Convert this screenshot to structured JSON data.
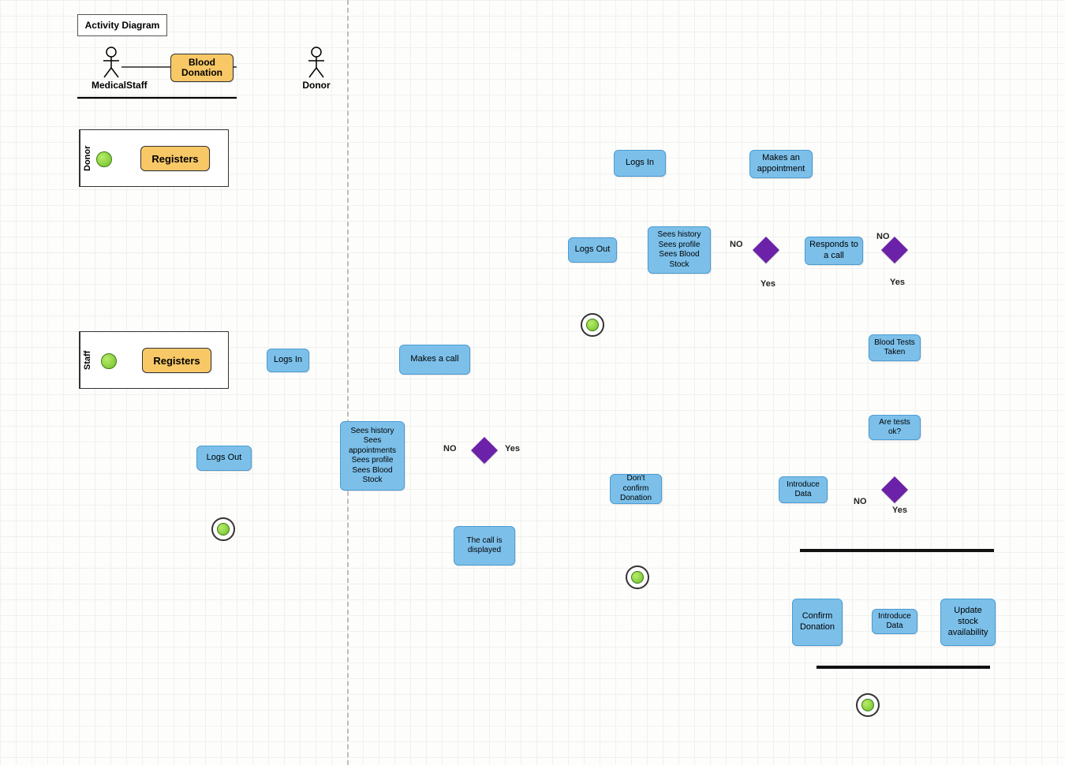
{
  "title": "Activity Diagram",
  "usecase": {
    "label": "Blood Donation",
    "actors": {
      "left": "MedicalStaff",
      "right": "Donor"
    }
  },
  "swimlanes": {
    "donor": "Donor",
    "staff": "Staff"
  },
  "nodes": {
    "registers": "Registers",
    "logsIn": "Logs In",
    "makesAppt": "Makes an appointment",
    "respondsCall": "Responds to a call",
    "seesDonor": "Sees history\nSees profile\nSees Blood Stock",
    "logsOutDonor": "Logs Out",
    "bloodTests": "Blood Tests Taken",
    "testsOk": "Are tests ok?",
    "introData": "Introduce Data",
    "dontConfirm": "Don't confirm Donation",
    "confirm": "Confirm Donation",
    "introData2": "Introduce Data",
    "updateStock": "Update stock availability",
    "registersStaff": "Registers",
    "logsInStaff": "Logs In",
    "makesCall": "Makes a call",
    "callDisplayed": "The call is displayed",
    "seesStaff": "Sees history\nSees appointments\nSees profile\nSees Blood Stock",
    "logsOutStaff": "Logs Out"
  },
  "edges": {
    "yes": "Yes",
    "no": "NO"
  }
}
